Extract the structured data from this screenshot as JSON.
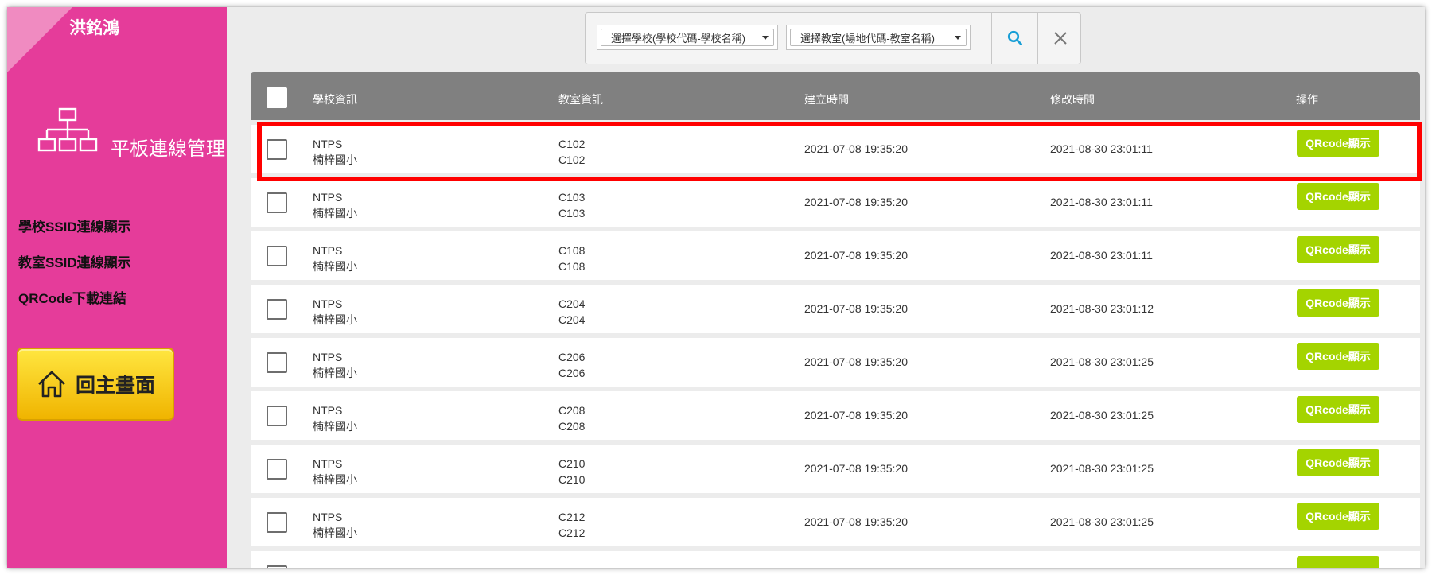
{
  "sidebar": {
    "user_name": "洪銘鴻",
    "module_title": "平板連線管理",
    "nav": [
      "學校SSID連線顯示",
      "教室SSID連線顯示",
      "QRCode下載連結"
    ],
    "home_label": "回主畫面"
  },
  "filter": {
    "school_select": "選擇學校(學校代碼-學校名稱)",
    "classroom_select": "選擇教室(場地代碼-教室名稱)"
  },
  "table": {
    "headers": {
      "school": "學校資訊",
      "classroom": "教室資訊",
      "created": "建立時間",
      "modified": "修改時間",
      "action": "操作"
    },
    "rows": [
      {
        "school_code": "NTPS",
        "school_name": "楠梓國小",
        "room_code": "C102",
        "room_name": "C102",
        "created": "2021-07-08 19:35:20",
        "modified": "2021-08-30 23:01:11",
        "action": "QRcode顯示"
      },
      {
        "school_code": "NTPS",
        "school_name": "楠梓國小",
        "room_code": "C103",
        "room_name": "C103",
        "created": "2021-07-08 19:35:20",
        "modified": "2021-08-30 23:01:11",
        "action": "QRcode顯示"
      },
      {
        "school_code": "NTPS",
        "school_name": "楠梓國小",
        "room_code": "C108",
        "room_name": "C108",
        "created": "2021-07-08 19:35:20",
        "modified": "2021-08-30 23:01:11",
        "action": "QRcode顯示"
      },
      {
        "school_code": "NTPS",
        "school_name": "楠梓國小",
        "room_code": "C204",
        "room_name": "C204",
        "created": "2021-07-08 19:35:20",
        "modified": "2021-08-30 23:01:12",
        "action": "QRcode顯示"
      },
      {
        "school_code": "NTPS",
        "school_name": "楠梓國小",
        "room_code": "C206",
        "room_name": "C206",
        "created": "2021-07-08 19:35:20",
        "modified": "2021-08-30 23:01:25",
        "action": "QRcode顯示"
      },
      {
        "school_code": "NTPS",
        "school_name": "楠梓國小",
        "room_code": "C208",
        "room_name": "C208",
        "created": "2021-07-08 19:35:20",
        "modified": "2021-08-30 23:01:25",
        "action": "QRcode顯示"
      },
      {
        "school_code": "NTPS",
        "school_name": "楠梓國小",
        "room_code": "C210",
        "room_name": "C210",
        "created": "2021-07-08 19:35:20",
        "modified": "2021-08-30 23:01:25",
        "action": "QRcode顯示"
      },
      {
        "school_code": "NTPS",
        "school_name": "楠梓國小",
        "room_code": "C212",
        "room_name": "C212",
        "created": "2021-07-08 19:35:20",
        "modified": "2021-08-30 23:01:25",
        "action": "QRcode顯示"
      },
      {
        "school_code": "",
        "school_name": "",
        "room_code": "",
        "room_name": "",
        "created": "",
        "modified": "",
        "action": ""
      }
    ]
  },
  "colors": {
    "sidebar": "#e53c9a",
    "header": "#808080",
    "qr_button": "#a4d400",
    "home_button": "#f5c800",
    "highlight": "#ff0000",
    "search_icon": "#1a9fd6"
  }
}
